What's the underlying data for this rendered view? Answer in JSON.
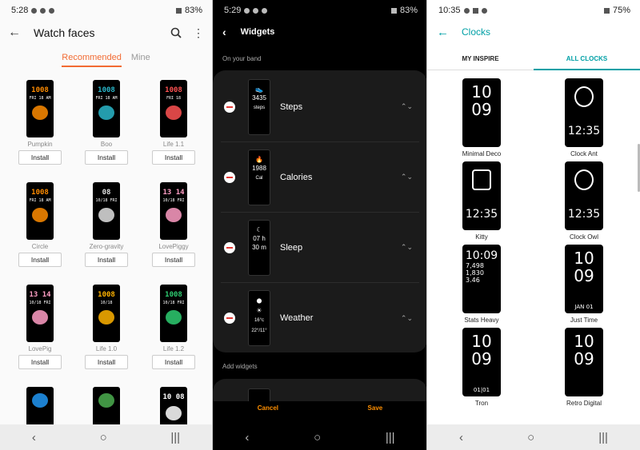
{
  "panel1": {
    "status": {
      "time": "5:28",
      "battery": "83%"
    },
    "header": {
      "title": "Watch faces"
    },
    "tabs": [
      {
        "label": "Recommended"
      },
      {
        "label": "Mine"
      }
    ],
    "install_label": "Install",
    "faces": [
      {
        "name": "Pumpkin",
        "time": "1008",
        "date": "FRI 18 AM"
      },
      {
        "name": "Boo",
        "time": "1008",
        "date": "FRI 18 AM"
      },
      {
        "name": "Life 1.1",
        "time": "1008",
        "date": "FRI 18"
      },
      {
        "name": "Circle",
        "time": "1008",
        "date": "FRI 18 AM"
      },
      {
        "name": "Zero-gravity",
        "time": "08",
        "date": "10/18 FRI"
      },
      {
        "name": "LovePiggy",
        "time": "13 14",
        "date": "10/18 FRI"
      },
      {
        "name": "LovePig",
        "time": "13 14",
        "date": "10/18 FRI"
      },
      {
        "name": "Life 1.0",
        "time": "1008",
        "date": "10/18"
      },
      {
        "name": "Life 1.2",
        "time": "1008",
        "date": "10/18 FRI"
      },
      {
        "name": "",
        "time": "",
        "date": ""
      },
      {
        "name": "",
        "time": "",
        "date": ""
      },
      {
        "name": "",
        "time": "10 08",
        "date": ""
      }
    ]
  },
  "panel2": {
    "status": {
      "time": "5:29",
      "battery": "83%"
    },
    "header": {
      "title": "Widgets"
    },
    "section_on_band": "On your band",
    "section_add": "Add widgets",
    "widgets": [
      {
        "label": "Steps",
        "value": "3435",
        "unit": "steps"
      },
      {
        "label": "Calories",
        "value": "1988",
        "unit": "Cal"
      },
      {
        "label": "Sleep",
        "value": "07 h",
        "unit": "30 m"
      },
      {
        "label": "Weather",
        "value": "16°c",
        "unit": "22°/11°"
      }
    ],
    "cancel_label": "Cancel",
    "save_label": "Save"
  },
  "panel3": {
    "status": {
      "time": "10:35",
      "battery": "75%"
    },
    "header": {
      "title": "Clocks"
    },
    "tabs": [
      {
        "label": "MY INSPIRE"
      },
      {
        "label": "ALL CLOCKS"
      }
    ],
    "clocks": [
      {
        "name": "Minimal Deco",
        "face": "10 09"
      },
      {
        "name": "Clock Ant",
        "face": "12:35"
      },
      {
        "name": "Kitty",
        "face": "12:35"
      },
      {
        "name": "Clock Owl",
        "face": "12:35"
      },
      {
        "name": "Stats Heavy",
        "face": "10:09",
        "stats": [
          "7,498",
          "1,830",
          "3.46"
        ]
      },
      {
        "name": "Just Time",
        "face": "10 09",
        "date": "JAN 01"
      },
      {
        "name": "Tron",
        "face": "10 09",
        "date": "01|01"
      },
      {
        "name": "Retro Digital",
        "face": "10 09"
      }
    ]
  },
  "colors": {
    "accent_orange": "#f26b33",
    "accent_teal": "#00a0a6",
    "remove_red": "#e53935",
    "action_orange": "#ff8f00"
  }
}
